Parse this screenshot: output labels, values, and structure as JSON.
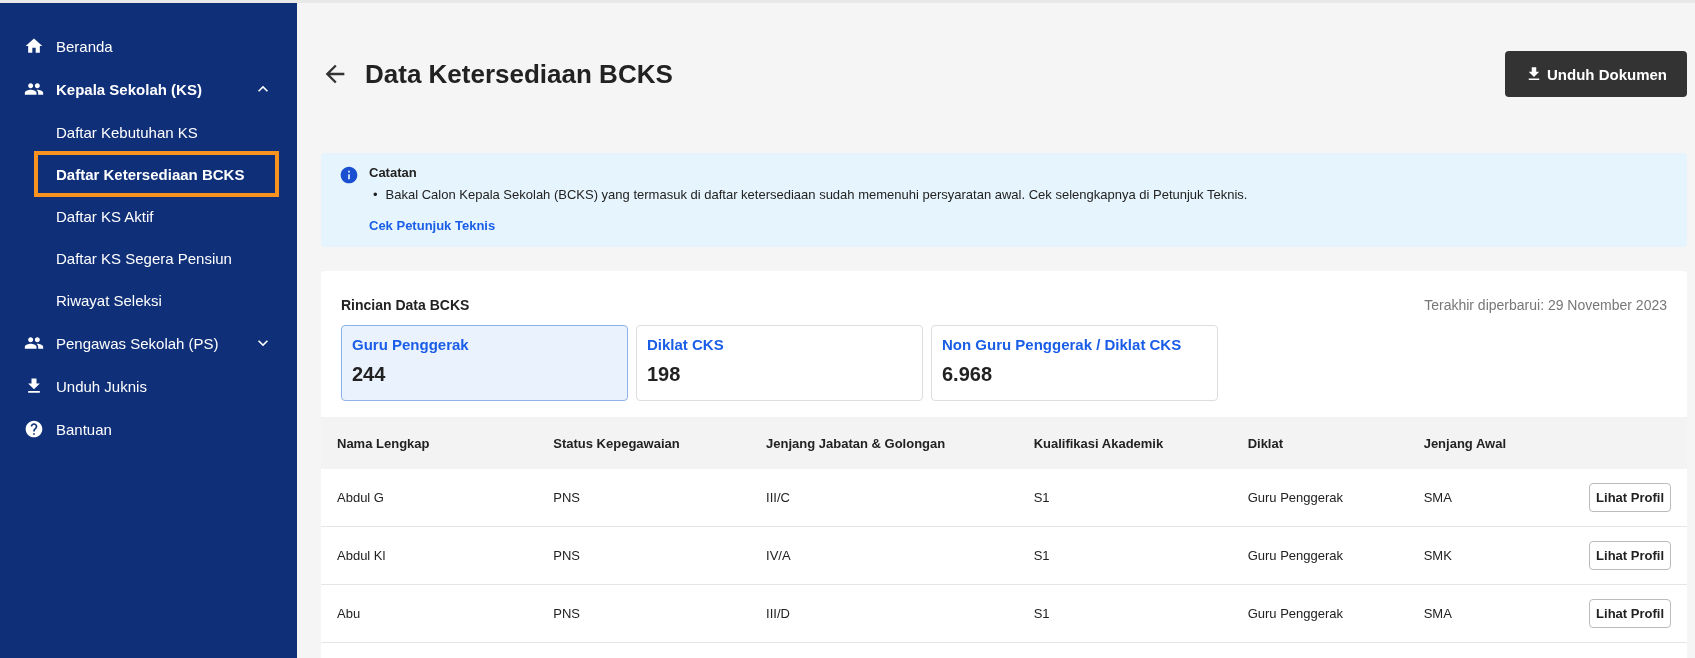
{
  "sidebar": {
    "items": [
      {
        "label": "Beranda",
        "selected": false
      },
      {
        "label": "Kepala Sekolah (KS)",
        "expanded": true,
        "children": [
          {
            "label": "Daftar Kebutuhan KS",
            "selected": false
          },
          {
            "label": "Daftar Ketersediaan BCKS",
            "selected": true
          },
          {
            "label": "Daftar KS Aktif",
            "selected": false
          },
          {
            "label": "Daftar KS Segera Pensiun",
            "selected": false
          },
          {
            "label": "Riwayat Seleksi",
            "selected": false
          }
        ]
      },
      {
        "label": "Pengawas Sekolah (PS)",
        "expanded": false
      },
      {
        "label": "Unduh Juknis",
        "selected": false
      },
      {
        "label": "Bantuan",
        "selected": false
      }
    ]
  },
  "header": {
    "title": "Data Ketersediaan BCKS",
    "button": "Unduh Dokumen"
  },
  "note": {
    "title": "Catatan",
    "bullets": [
      {
        "marker": "•",
        "text": "Bakal Calon Kepala Sekolah (BCKS) yang termasuk di daftar ketersediaan sudah memenuhi persyaratan awal. Cek selengkapnya di Petunjuk Teknis."
      }
    ],
    "link": "Cek Petunjuk Teknis"
  },
  "details": {
    "title": "Rincian Data BCKS",
    "updated": "Terakhir diperbarui: 29 November 2023",
    "stats": [
      {
        "label": "Guru Penggerak",
        "value": "244",
        "selected": true
      },
      {
        "label": "Diklat CKS",
        "value": "198",
        "selected": false
      },
      {
        "label": "Non Guru Penggerak / Diklat CKS",
        "value": "6.968",
        "selected": false
      }
    ]
  },
  "table": {
    "columns": [
      "Nama Lengkap",
      "Status Kepegawaian",
      "Jenjang Jabatan & Golongan",
      "Kualifikasi Akademik",
      "Diklat",
      "Jenjang Awal"
    ],
    "rows": [
      {
        "cells": [
          "Abdul G",
          "PNS",
          "III/C",
          "S1",
          "Guru Penggerak",
          "SMA"
        ],
        "action": "Lihat Profil"
      },
      {
        "cells": [
          "Abdul Kl",
          "PNS",
          "IV/A",
          "S1",
          "Guru Penggerak",
          "SMK"
        ],
        "action": "Lihat Profil"
      },
      {
        "cells": [
          "Abu",
          "PNS",
          "III/D",
          "S1",
          "Guru Penggerak",
          "SMA"
        ],
        "action": "Lihat Profil"
      }
    ]
  }
}
